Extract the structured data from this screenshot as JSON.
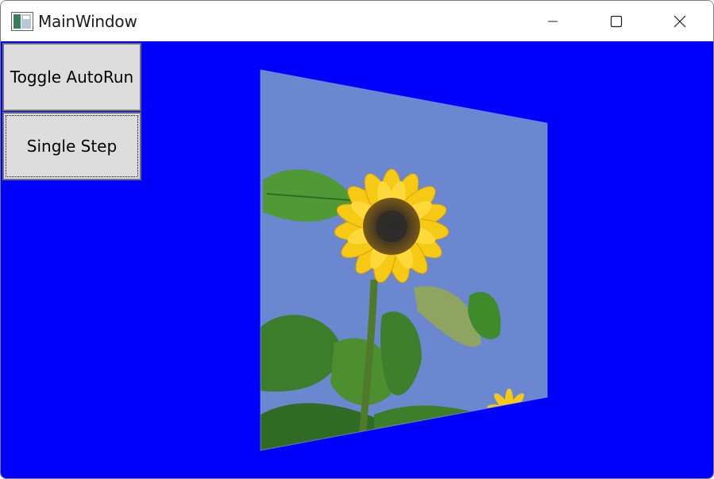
{
  "window": {
    "title": "MainWindow",
    "controls": {
      "minimize_icon": "minimize-icon",
      "maximize_icon": "maximize-icon",
      "close_icon": "close-icon"
    }
  },
  "toolbar": {
    "toggle_autorun_label": "Toggle AutoRun",
    "single_step_label": "Single Step"
  },
  "scene": {
    "background_color": "#0000ff",
    "image_subject": "sunflower",
    "sky_color": "#6a87cf"
  }
}
